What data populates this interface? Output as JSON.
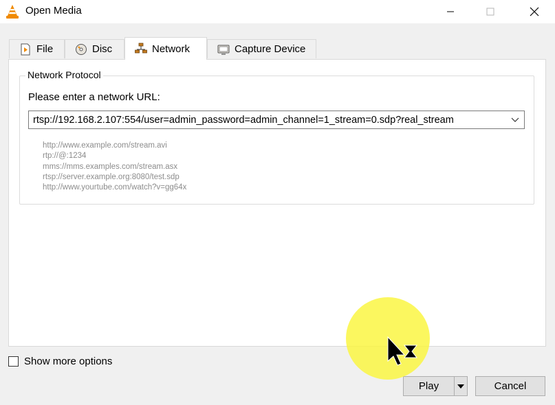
{
  "window": {
    "title": "Open Media",
    "icon": "vlc-cone-icon",
    "controls": [
      "minimize-icon",
      "maximize-icon",
      "close-icon"
    ]
  },
  "tabs": [
    {
      "label": "File",
      "icon": "file-icon",
      "active": false
    },
    {
      "label": "Disc",
      "icon": "disc-icon",
      "active": false
    },
    {
      "label": "Network",
      "icon": "network-icon",
      "active": true
    },
    {
      "label": "Capture Device",
      "icon": "capture-device-icon",
      "active": false
    }
  ],
  "network": {
    "group_title": "Network Protocol",
    "prompt": "Please enter a network URL:",
    "url_value": "rtsp://192.168.2.107:554/user=admin_password=admin_channel=1_stream=0.sdp?real_stream",
    "examples": [
      "http://www.example.com/stream.avi",
      "rtp://@:1234",
      "mms://mms.examples.com/stream.asx",
      "rtsp://server.example.org:8080/test.sdp",
      "http://www.yourtube.com/watch?v=gg64x"
    ]
  },
  "options": {
    "show_more_label": "Show more options",
    "show_more_checked": false
  },
  "buttons": {
    "play_label": "Play",
    "cancel_label": "Cancel"
  },
  "colors": {
    "highlight": "#faf53c",
    "vlc_orange": "#f08a00"
  }
}
